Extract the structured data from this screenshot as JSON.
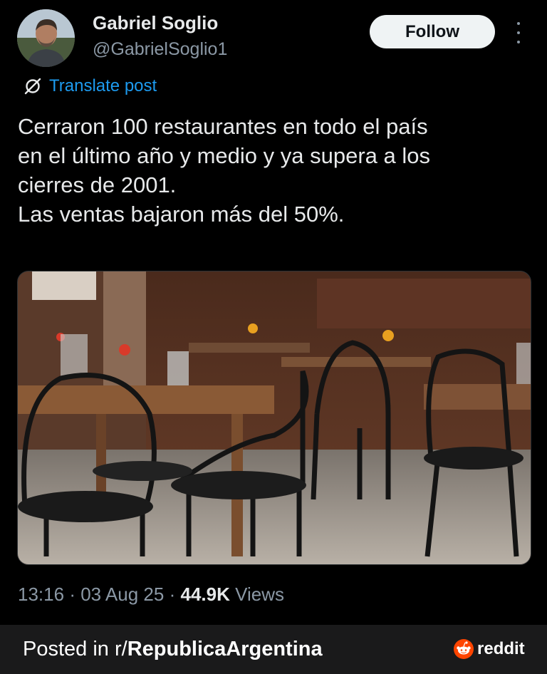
{
  "author": {
    "name": "Gabriel Soglio",
    "handle": "@GabrielSoglio1",
    "avatar_icon": "profile-photo"
  },
  "actions": {
    "follow_label": "Follow",
    "more_icon": "more-vertical-icon"
  },
  "translate": {
    "label": "Translate post",
    "icon": "translate-icon"
  },
  "post": {
    "lines": [
      "Cerraron 100 restaurantes en todo el país",
      "en el último año y medio y ya supera a los",
      "cierres de 2001.",
      "Las ventas bajaron más del 50%."
    ]
  },
  "meta": {
    "time": "13:16",
    "date": "03 Aug 25",
    "separator": "·",
    "views_count": "44.9K",
    "views_label": "Views"
  },
  "footer": {
    "posted_prefix": "Posted in r/",
    "subreddit": "RepublicaArgentina",
    "brand": "reddit",
    "brand_color": "#ff4500"
  },
  "colors": {
    "background": "#000000",
    "text": "#e7e9ea",
    "secondary": "#8b98a5",
    "link": "#1d9bf0",
    "footer_bg": "#1a1a1b"
  }
}
